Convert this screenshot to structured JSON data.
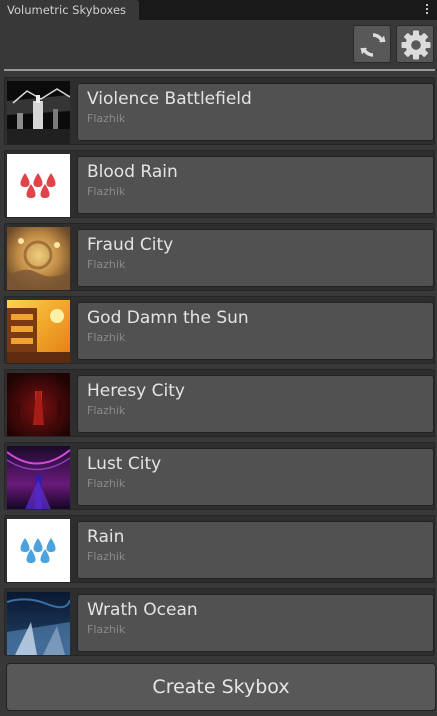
{
  "window": {
    "tab_title": "Volumetric Skyboxes"
  },
  "toolbar": {
    "refresh_icon": "refresh-icon",
    "settings_icon": "gear-icon"
  },
  "skyboxes": [
    {
      "name": "Violence Battlefield",
      "author": "Flazhik",
      "thumb": "violence"
    },
    {
      "name": "Blood Rain",
      "author": "Flazhik",
      "thumb": "blood",
      "drop_color": "#e0434a"
    },
    {
      "name": "Fraud City",
      "author": "Flazhik",
      "thumb": "fraud"
    },
    {
      "name": "God Damn the Sun",
      "author": "Flazhik",
      "thumb": "sun"
    },
    {
      "name": "Heresy City",
      "author": "Flazhik",
      "thumb": "heresy"
    },
    {
      "name": "Lust City",
      "author": "Flazhik",
      "thumb": "lust"
    },
    {
      "name": "Rain",
      "author": "Flazhik",
      "thumb": "rain",
      "drop_color": "#4aa3df"
    },
    {
      "name": "Wrath Ocean",
      "author": "Flazhik",
      "thumb": "wrath"
    }
  ],
  "footer": {
    "create_label": "Create Skybox"
  }
}
